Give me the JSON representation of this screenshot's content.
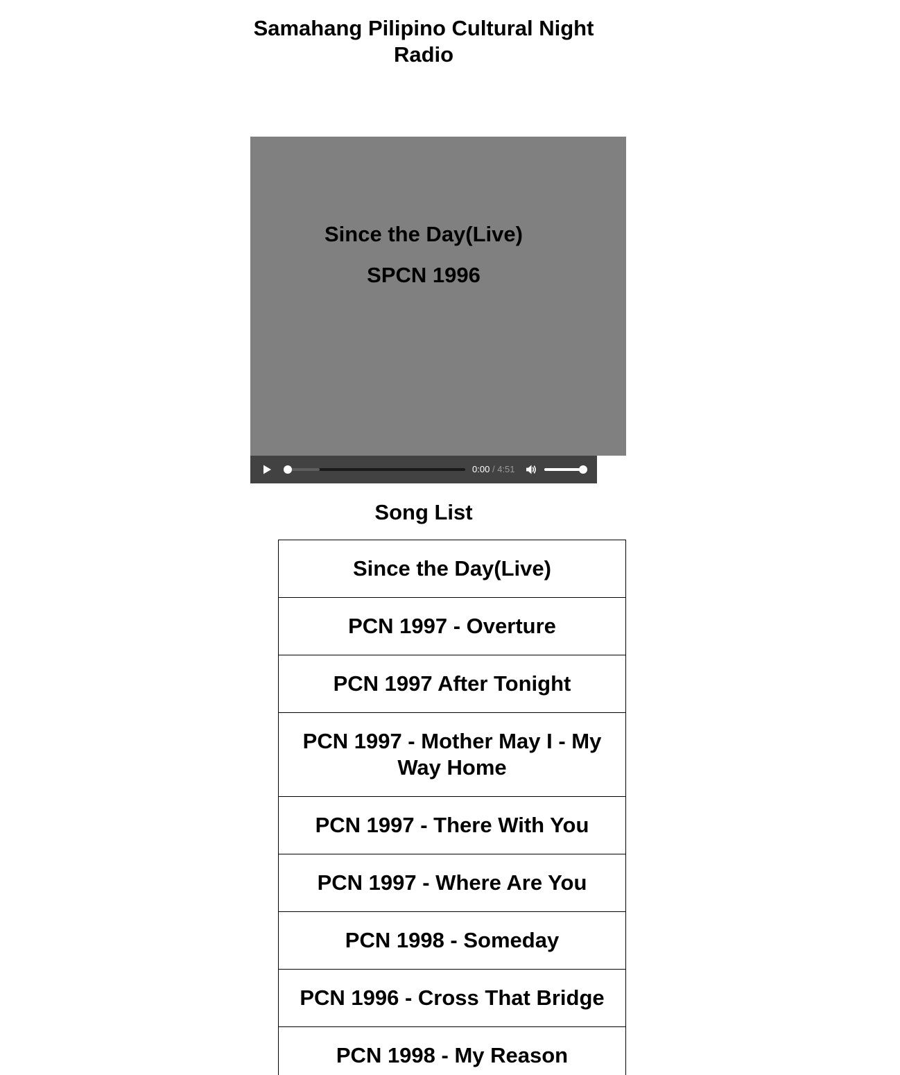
{
  "site": {
    "title": "Samahang Pilipino Cultural Night Radio"
  },
  "now_playing": {
    "title": "Since the Day(Live)",
    "album": "SPCN 1996"
  },
  "player": {
    "current_time": "0:00",
    "separator": "/",
    "duration": "4:51",
    "progress": 0,
    "buffered": 0.18,
    "volume": 1.0,
    "play_icon": "play-icon",
    "volume_icon": "speaker-icon"
  },
  "song_list": {
    "heading": "Song List",
    "songs": [
      "Since the Day(Live)",
      "PCN 1997 - Overture",
      "PCN 1997 After Tonight",
      "PCN 1997 - Mother May I - My Way Home",
      "PCN 1997 - There With You",
      "PCN 1997 - Where Are You",
      "PCN 1998 - Someday",
      "PCN 1996 - Cross That Bridge",
      "PCN 1998 - My Reason"
    ]
  },
  "colors": {
    "art_background": "#808080",
    "player_background": "#424242",
    "border": "#000000"
  }
}
